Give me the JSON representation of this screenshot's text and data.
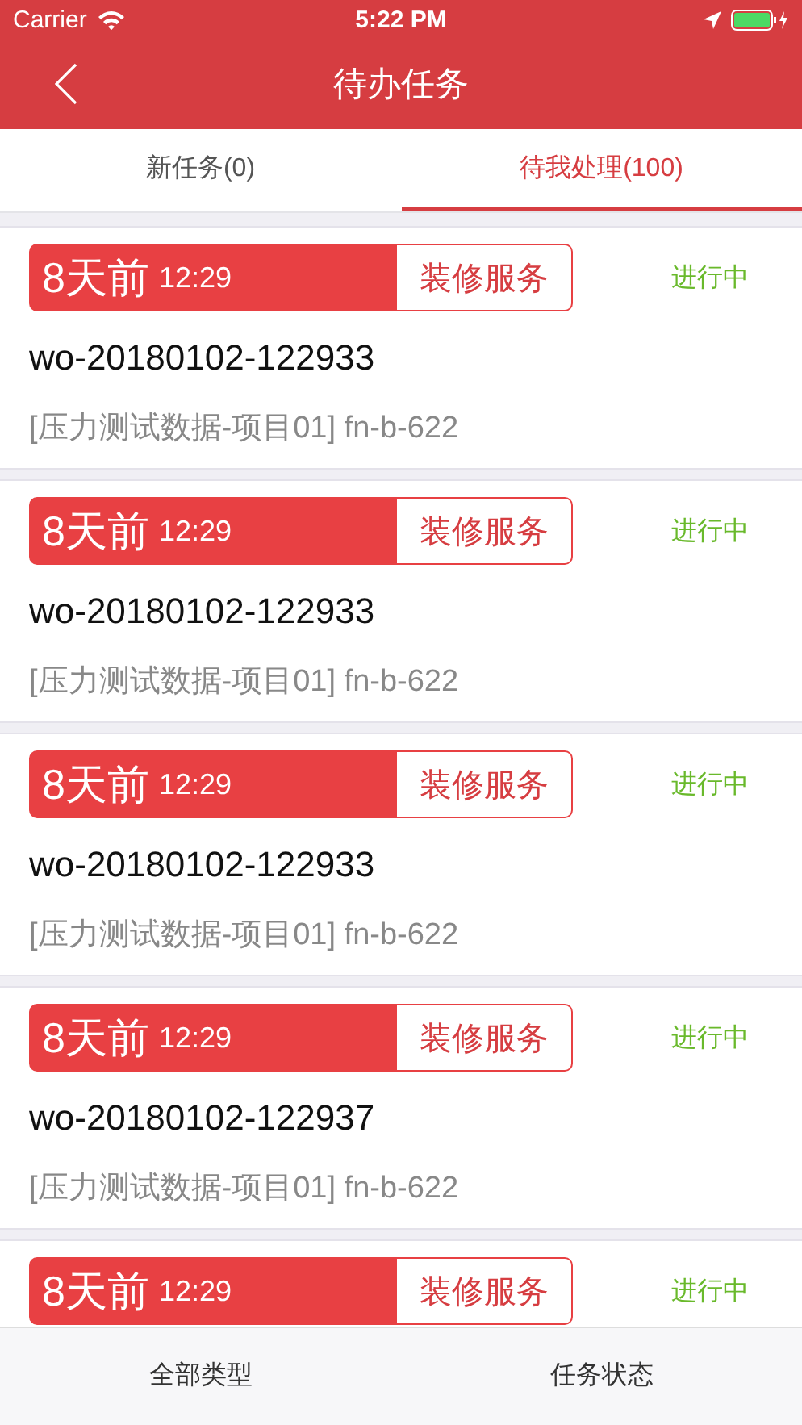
{
  "status_bar": {
    "carrier": "Carrier",
    "time": "5:22 PM"
  },
  "nav": {
    "title": "待办任务"
  },
  "tabs": [
    {
      "label": "新任务(0)",
      "selected": false
    },
    {
      "label": "待我处理(100)",
      "selected": true
    }
  ],
  "tasks": [
    {
      "ago": "8天前",
      "time": "12:29",
      "service": "装修服务",
      "status": "进行中",
      "number": "wo-20180102-122933",
      "desc": "[压力测试数据-项目01] fn-b-622"
    },
    {
      "ago": "8天前",
      "time": "12:29",
      "service": "装修服务",
      "status": "进行中",
      "number": "wo-20180102-122933",
      "desc": "[压力测试数据-项目01] fn-b-622"
    },
    {
      "ago": "8天前",
      "time": "12:29",
      "service": "装修服务",
      "status": "进行中",
      "number": "wo-20180102-122933",
      "desc": "[压力测试数据-项目01] fn-b-622"
    },
    {
      "ago": "8天前",
      "time": "12:29",
      "service": "装修服务",
      "status": "进行中",
      "number": "wo-20180102-122937",
      "desc": "[压力测试数据-项目01] fn-b-622"
    },
    {
      "ago": "8天前",
      "time": "12:29",
      "service": "装修服务",
      "status": "进行中"
    }
  ],
  "bottom_bar": [
    "全部类型",
    "任务状态"
  ]
}
